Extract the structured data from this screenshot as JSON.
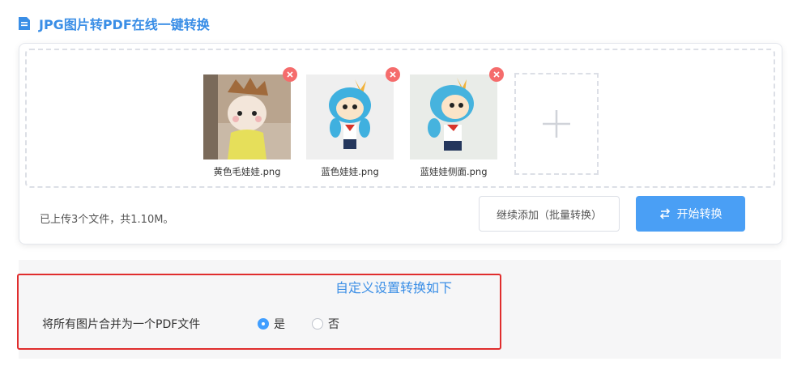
{
  "header": {
    "title": "JPG图片转PDF在线一键转换",
    "icon": "document-icon",
    "color": "#3a8ee6"
  },
  "upload": {
    "files": [
      {
        "name": "黄色毛娃娃.png",
        "remove_icon": "close-icon"
      },
      {
        "name": "蓝色娃娃.png",
        "remove_icon": "close-icon"
      },
      {
        "name": "蓝娃娃侧面.png",
        "remove_icon": "close-icon"
      }
    ],
    "add_icon": "plus-icon",
    "status": "已上传3个文件，共1.10M。",
    "continue_label": "继续添加（批量转换）",
    "start_label": "开始转换",
    "start_icon": "swap-icon",
    "accent": "#4a9ff5"
  },
  "settings": {
    "title": "自定义设置转换如下",
    "merge_label": "将所有图片合并为一个PDF文件",
    "options": [
      {
        "label": "是",
        "selected": true
      },
      {
        "label": "否",
        "selected": false
      }
    ],
    "highlight_color": "#e02d2d"
  }
}
